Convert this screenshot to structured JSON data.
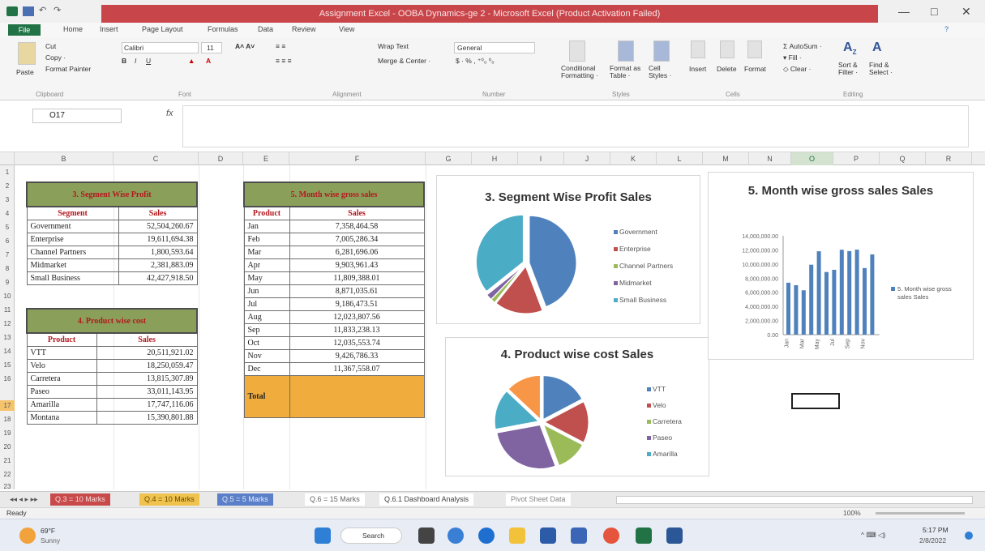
{
  "window": {
    "title": "Assignment Excel - OOBA Dynamics-ge 2 - Microsoft Excel (Product Activation Failed)",
    "controls": [
      "—",
      "□",
      "✕"
    ]
  },
  "ribbon_tabs": [
    "File",
    "Home",
    "Insert",
    "Page Layout",
    "Formulas",
    "Data",
    "Review",
    "View"
  ],
  "ribbon": {
    "clipboard": {
      "paste": "Paste",
      "cut": "Cut",
      "copy": "Copy ·",
      "format_painter": "Format Painter",
      "group": "Clipboard"
    },
    "font": {
      "name": "Calibri",
      "size": "11",
      "group": "Font"
    },
    "alignment": {
      "wrap": "Wrap Text",
      "merge": "Merge & Center ·",
      "group": "Alignment"
    },
    "number": {
      "format": "General",
      "group": "Number"
    },
    "styles": {
      "conditional": "Conditional Formatting ·",
      "format_table": "Format as Table ·",
      "cell_styles": "Cell Styles ·",
      "group": "Styles"
    },
    "cells": {
      "insert": "Insert",
      "delete": "Delete",
      "format": "Format",
      "group": "Cells"
    },
    "editing": {
      "autosum": "AutoSum ·",
      "fill": "Fill ·",
      "clear": "Clear ·",
      "sort": "Sort & Filter ·",
      "find": "Find & Select ·",
      "group": "Editing"
    }
  },
  "formula_bar": {
    "name_box": "O17",
    "fx": "fx",
    "value": ""
  },
  "columns": [
    "B",
    "C",
    "D",
    "E",
    "F",
    "G",
    "H",
    "I",
    "J",
    "K",
    "L",
    "M",
    "N",
    "O",
    "P",
    "Q",
    "R"
  ],
  "rows": [
    "1",
    "2",
    "3",
    "4",
    "5",
    "6",
    "7",
    "8",
    "9",
    "10",
    "11",
    "12",
    "13",
    "14",
    "15",
    "16",
    "17",
    "18",
    "19",
    "20",
    "21",
    "22",
    "23"
  ],
  "segment_table": {
    "title": "3. Segment Wise Profit",
    "headers": [
      "Segment",
      "Sales"
    ],
    "rows": [
      [
        "Government",
        "52,504,260.67"
      ],
      [
        "Enterprise",
        "19,611,694.38"
      ],
      [
        "Channel Partners",
        "1,800,593.64"
      ],
      [
        "Midmarket",
        "2,381,883.09"
      ],
      [
        "Small Business",
        "42,427,918.50"
      ]
    ]
  },
  "product_table": {
    "title": "4. Product wise cost",
    "headers": [
      "Product",
      "Sales"
    ],
    "rows": [
      [
        "VTT",
        "20,511,921.02"
      ],
      [
        "Velo",
        "18,250,059.47"
      ],
      [
        "Carretera",
        "13,815,307.89"
      ],
      [
        "Paseo",
        "33,011,143.95"
      ],
      [
        "Amarilla",
        "17,747,116.06"
      ],
      [
        "Montana",
        "15,390,801.88"
      ]
    ]
  },
  "month_table": {
    "title": "5. Month wise gross sales",
    "headers": [
      "Product",
      "Sales"
    ],
    "rows": [
      [
        "Jan",
        "7,358,464.58"
      ],
      [
        "Feb",
        "7,005,286.34"
      ],
      [
        "Mar",
        "6,281,696.06"
      ],
      [
        "Apr",
        "9,903,961.43"
      ],
      [
        "May",
        "11,809,388.01"
      ],
      [
        "Jun",
        "8,871,035.61"
      ],
      [
        "Jul",
        "9,186,473.51"
      ],
      [
        "Aug",
        "12,023,807.56"
      ],
      [
        "Sep",
        "11,833,238.13"
      ],
      [
        "Oct",
        "12,035,553.74"
      ],
      [
        "Nov",
        "9,426,786.33"
      ],
      [
        "Dec",
        "11,367,558.07"
      ]
    ],
    "total_label": "Total"
  },
  "chart_data": [
    {
      "type": "pie",
      "title": "3. Segment Wise Profit Sales",
      "categories": [
        "Government",
        "Enterprise",
        "Channel Partners",
        "Midmarket",
        "Small Business"
      ],
      "values": [
        52504260.67,
        19611694.38,
        1800593.64,
        2381883.09,
        42427918.5
      ],
      "colors": [
        "#4f81bd",
        "#c0504d",
        "#9bbb59",
        "#8064a2",
        "#4bacc6"
      ],
      "legend": "right"
    },
    {
      "type": "pie",
      "title": "4. Product wise cost Sales",
      "categories": [
        "VTT",
        "Velo",
        "Carretera",
        "Paseo",
        "Amarilla"
      ],
      "values": [
        20511921.02,
        18250059.47,
        13815307.89,
        33011143.95,
        17747116.06,
        15390801.88
      ],
      "colors": [
        "#4f81bd",
        "#c0504d",
        "#9bbb59",
        "#8064a2",
        "#4bacc6",
        "#f79646"
      ],
      "legend": "right"
    },
    {
      "type": "bar",
      "title": "5. Month wise gross sales Sales",
      "categories": [
        "Jan",
        "Feb",
        "Mar",
        "Apr",
        "May",
        "Jun",
        "Jul",
        "Aug",
        "Sep",
        "Oct",
        "Nov",
        "Dec"
      ],
      "series": [
        {
          "name": "5. Month wise gross sales Sales",
          "values": [
            7358464.58,
            7005286.34,
            6281696.06,
            9903961.43,
            11809388.01,
            8871035.61,
            9186473.51,
            12023807.56,
            11833238.13,
            12035553.74,
            9426786.33,
            11367558.07
          ]
        }
      ],
      "y_ticks": [
        "14,000,000.00",
        "12,000,000.00",
        "10,000,000.00",
        "8,000,000.00",
        "6,000,000.00",
        "4,000,000.00",
        "2,000,000.00",
        "0.00"
      ],
      "x_tick_labels": [
        "Jan",
        "Mar",
        "May",
        "Jul",
        "Sep",
        "Nov"
      ],
      "ylim": [
        0,
        14000000
      ],
      "color": "#4f81bd",
      "legend": "right"
    }
  ],
  "sheet_tabs": [
    "Q.3 = 10 Marks",
    "Q.4 = 10 Marks",
    "Q.5 = 5 Marks",
    "Q.6 = 15 Marks",
    "Q.6.1 Dashboard Analysis",
    "Pivot Sheet Data"
  ],
  "status": {
    "ready": "Ready",
    "zoom": "100%"
  },
  "taskbar": {
    "weather_temp": "69°F",
    "weather_desc": "Sunny",
    "search": "Search",
    "time": "5:17 PM",
    "date": "2/8/2022"
  },
  "colors": {
    "excel_green": "#217346",
    "title_red": "#c8454a",
    "table_header": "#8aa05a",
    "total_fill": "#f0ad3e"
  }
}
